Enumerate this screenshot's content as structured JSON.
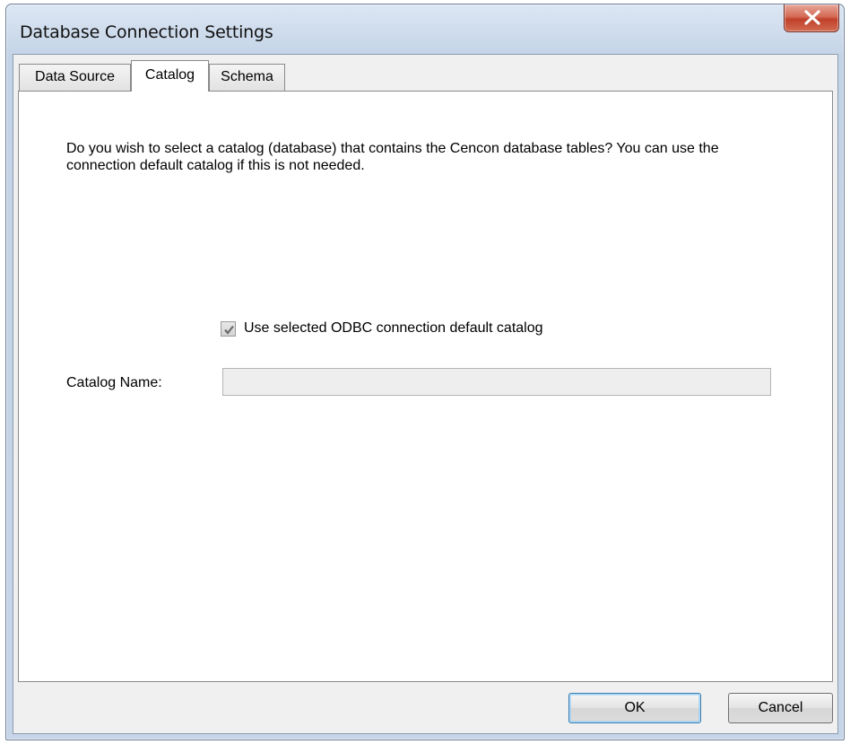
{
  "window": {
    "title": "Database Connection Settings"
  },
  "tabs": [
    {
      "label": "Data Source",
      "active": false
    },
    {
      "label": "Catalog",
      "active": true
    },
    {
      "label": "Schema",
      "active": false
    }
  ],
  "catalog_tab": {
    "description": "Do you wish to select a catalog (database) that contains the Cencon database tables?  You can use the connection default catalog if this is not needed.",
    "use_default_checkbox": {
      "label": "Use selected ODBC connection default catalog",
      "checked": true
    },
    "catalog_name": {
      "label": "Catalog Name:",
      "value": ""
    }
  },
  "buttons": {
    "ok": "OK",
    "cancel": "Cancel"
  },
  "colors": {
    "close_button": "#c0402b",
    "title_bar": "#cbd9ea",
    "panel_background": "#ffffff",
    "dialog_background": "#f0f0f0"
  },
  "icons": {
    "close": "close-icon",
    "check": "checkmark-icon"
  }
}
